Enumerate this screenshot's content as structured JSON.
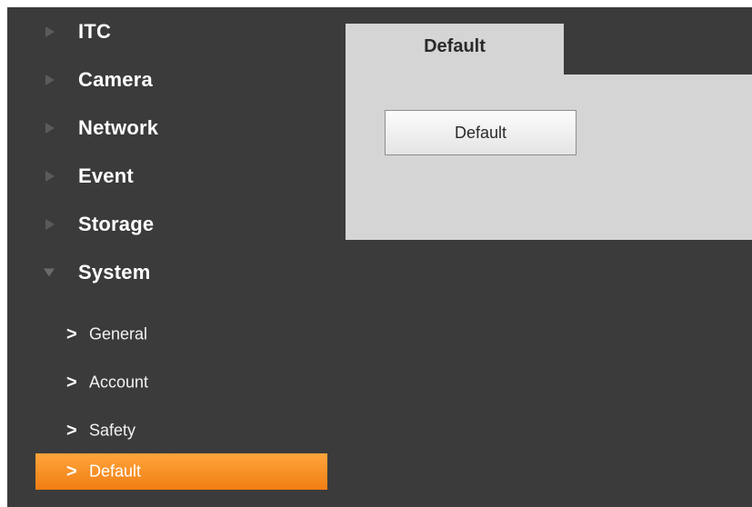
{
  "sidebar": {
    "sections": [
      {
        "label": "ITC",
        "icon": "triangle-right-icon",
        "expanded": false
      },
      {
        "label": "Camera",
        "icon": "triangle-right-icon",
        "expanded": false
      },
      {
        "label": "Network",
        "icon": "triangle-right-icon",
        "expanded": false
      },
      {
        "label": "Event",
        "icon": "triangle-right-icon",
        "expanded": false
      },
      {
        "label": "Storage",
        "icon": "triangle-right-icon",
        "expanded": false
      },
      {
        "label": "System",
        "icon": "triangle-down-icon",
        "expanded": true
      }
    ],
    "sub_items": [
      {
        "label": "General",
        "icon": "chevron-right-icon",
        "active": false
      },
      {
        "label": "Account",
        "icon": "chevron-right-icon",
        "active": false
      },
      {
        "label": "Safety",
        "icon": "chevron-right-icon",
        "active": false
      },
      {
        "label": "Default",
        "icon": "chevron-right-icon",
        "active": true
      }
    ],
    "chevron_glyph": ">"
  },
  "main": {
    "tab_label": "Default",
    "button_label": "Default"
  },
  "colors": {
    "background": "#3b3b3b",
    "panel": "#d5d5d5",
    "active_item_accent": "#f5901f"
  }
}
